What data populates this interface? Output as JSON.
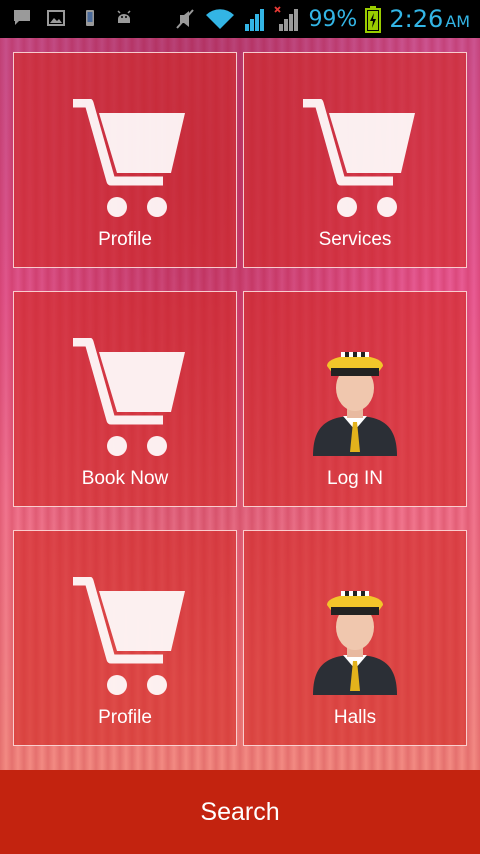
{
  "status_bar": {
    "icons": [
      "message-icon",
      "image-icon",
      "phone-icon",
      "android-icon",
      "mute-icon",
      "wifi-icon",
      "signal-icon",
      "signal-no-data-icon",
      "battery-charging-icon"
    ],
    "battery": "99%",
    "time": "2:26",
    "ampm": "AM",
    "accent": "#33b5e5"
  },
  "tiles": [
    {
      "label": "Profile",
      "icon": "cart-icon"
    },
    {
      "label": "Services",
      "icon": "cart-icon"
    },
    {
      "label": "Book Now",
      "icon": "cart-icon"
    },
    {
      "label": "Log IN",
      "icon": "driver-avatar-icon"
    },
    {
      "label": "Profile",
      "icon": "cart-icon"
    },
    {
      "label": "Halls",
      "icon": "driver-avatar-icon"
    }
  ],
  "search_button": {
    "label": "Search",
    "color": "#c3230f"
  }
}
